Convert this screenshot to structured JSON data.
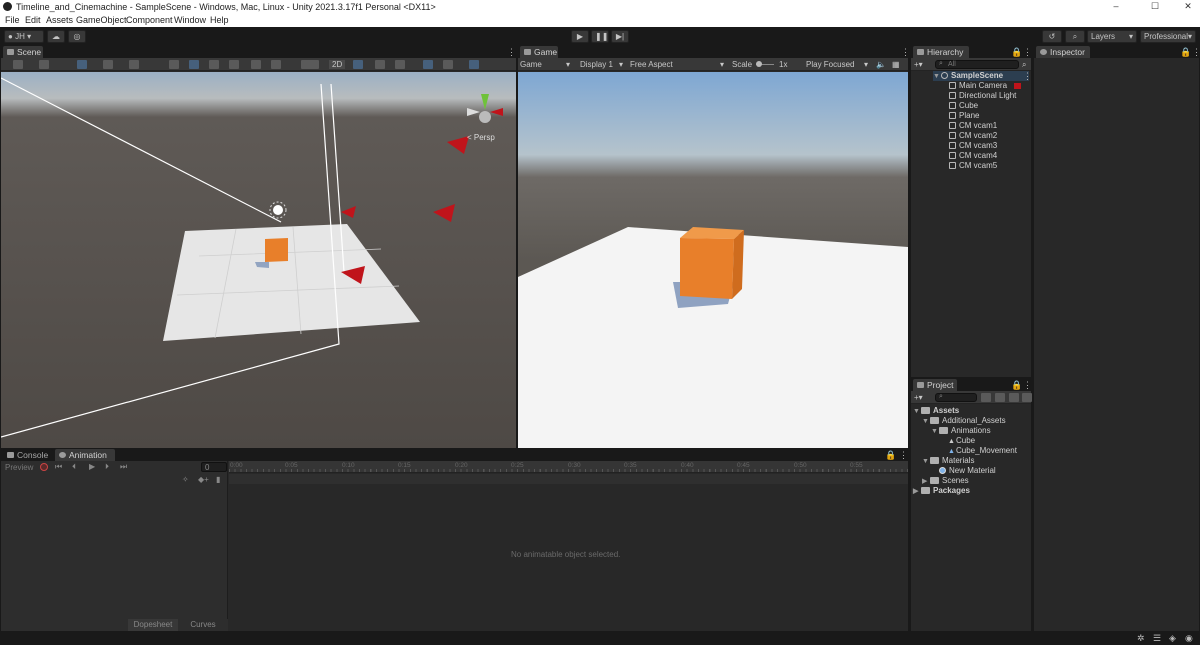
{
  "window": {
    "title": "Timeline_and_Cinemachine - SampleScene - Windows, Mac, Linux - Unity 2021.3.17f1 Personal <DX11>",
    "min": "–",
    "max": "☐",
    "close": "✕"
  },
  "menu": [
    "File",
    "Edit",
    "Assets",
    "GameObject",
    "Component",
    "Window",
    "Help"
  ],
  "toolbar": {
    "account": "JH",
    "layers": "Layers",
    "layout": "Professional"
  },
  "scene": {
    "tab": "Scene",
    "mode_2d": "2D",
    "persp": "< Persp"
  },
  "game": {
    "tab": "Game",
    "mode": "Game",
    "display": "Display 1",
    "aspect": "Free Aspect",
    "scale_label": "Scale",
    "scale_value": "1x",
    "play_focused": "Play Focused"
  },
  "hierarchy": {
    "tab": "Hierarchy",
    "search_placeholder": "All",
    "scene": "SampleScene",
    "items": [
      "Main Camera",
      "Directional Light",
      "Cube",
      "Plane",
      "CM vcam1",
      "CM vcam2",
      "CM vcam3",
      "CM vcam4",
      "CM vcam5"
    ]
  },
  "inspector": {
    "tab": "Inspector"
  },
  "project": {
    "tab": "Project",
    "root": "Assets",
    "items": [
      {
        "label": "Additional_Assets",
        "kind": "folder",
        "depth": 1,
        "open": true
      },
      {
        "label": "Animations",
        "kind": "folder",
        "depth": 2,
        "open": true
      },
      {
        "label": "Cube",
        "kind": "anim",
        "depth": 3
      },
      {
        "label": "Cube_Movement",
        "kind": "anim",
        "depth": 3
      },
      {
        "label": "Materials",
        "kind": "folder",
        "depth": 1,
        "open": true
      },
      {
        "label": "New Material",
        "kind": "material",
        "depth": 2
      },
      {
        "label": "Scenes",
        "kind": "folder",
        "depth": 1,
        "open": false
      }
    ],
    "packages": "Packages"
  },
  "bottom": {
    "console_tab": "Console",
    "animation_tab": "Animation",
    "preview": "Preview",
    "frame": "0",
    "ticks": [
      "0:00",
      "0:05",
      "0:10",
      "0:15",
      "0:20",
      "0:25",
      "0:30",
      "0:35",
      "0:40",
      "0:45",
      "0:50",
      "0:55"
    ],
    "empty_msg": "No animatable object selected.",
    "dopesheet": "Dopesheet",
    "curves": "Curves"
  },
  "colors": {
    "accent": "#46607c",
    "cube": "#e87f2a",
    "gizmo_red": "#c0141b",
    "sky": "#8db4d8"
  }
}
